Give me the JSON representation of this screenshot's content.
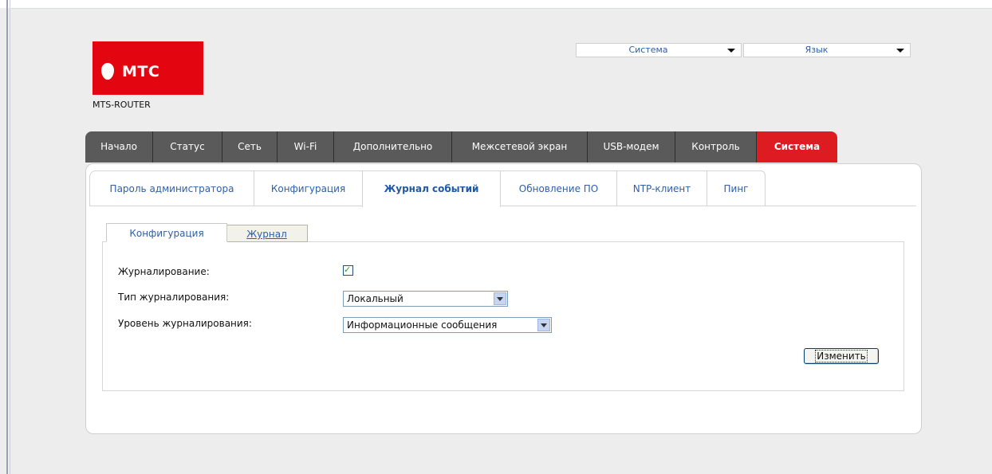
{
  "brand": {
    "logo_text": "МТС",
    "device_name": "MTS-ROUTER",
    "accent": "#e30611"
  },
  "top_dropdowns": [
    {
      "label": "Система"
    },
    {
      "label": "Язык"
    }
  ],
  "main_nav": [
    {
      "label": "Начало"
    },
    {
      "label": "Статус"
    },
    {
      "label": "Сеть"
    },
    {
      "label": "Wi-Fi"
    },
    {
      "label": "Дополнительно"
    },
    {
      "label": "Межсетевой экран"
    },
    {
      "label": "USB-модем"
    },
    {
      "label": "Контроль"
    },
    {
      "label": "Система",
      "active": true
    }
  ],
  "sub_nav": [
    {
      "label": "Пароль администратора"
    },
    {
      "label": "Конфигурация"
    },
    {
      "label": "Журнал событий",
      "active": true
    },
    {
      "label": "Обновление ПО"
    },
    {
      "label": "NTP-клиент"
    },
    {
      "label": "Пинг"
    }
  ],
  "inner_tabs": [
    {
      "label": "Конфигурация",
      "active": true
    },
    {
      "label": "Журнал"
    }
  ],
  "form": {
    "logging_label": "Журналирование:",
    "logging_enabled": true,
    "log_type_label": "Тип журналирования:",
    "log_type_value": "Локальный",
    "log_level_label": "Уровень журналирования:",
    "log_level_value": "Информационные сообщения",
    "submit_label": "Изменить"
  }
}
